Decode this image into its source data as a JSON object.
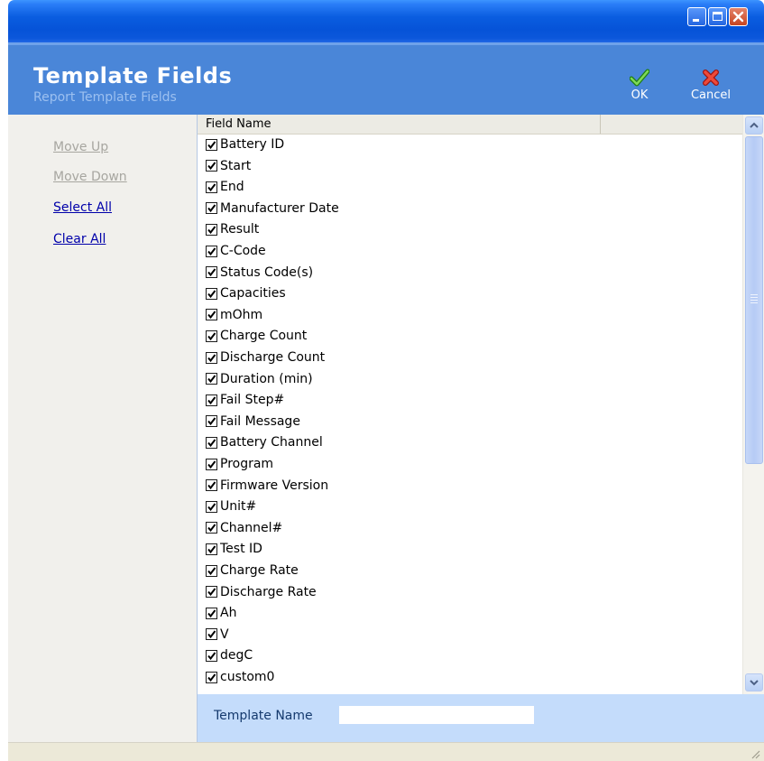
{
  "window": {
    "title": ""
  },
  "colors": {
    "header_bg": "#4a86d8",
    "titlebar": "#0653d8",
    "ok_green": "#2e9a20",
    "cancel_red": "#d9261c",
    "link_blue": "#0000aa"
  },
  "header": {
    "title": "Template Fields",
    "subtitle": "Report Template Fields",
    "ok_label": "OK",
    "cancel_label": "Cancel"
  },
  "sidebar": {
    "links": [
      {
        "label": "Move Up",
        "enabled": false
      },
      {
        "label": "Move Down",
        "enabled": false
      },
      {
        "label": "Select All",
        "enabled": true
      },
      {
        "label": "Clear All",
        "enabled": true
      }
    ]
  },
  "list": {
    "column_header": "Field Name",
    "fields": [
      {
        "label": "Battery ID",
        "checked": true
      },
      {
        "label": "Start",
        "checked": true
      },
      {
        "label": "End",
        "checked": true
      },
      {
        "label": "Manufacturer Date",
        "checked": true
      },
      {
        "label": "Result",
        "checked": true
      },
      {
        "label": "C-Code",
        "checked": true
      },
      {
        "label": "Status Code(s)",
        "checked": true
      },
      {
        "label": "Capacities",
        "checked": true
      },
      {
        "label": "mOhm",
        "checked": true
      },
      {
        "label": "Charge Count",
        "checked": true
      },
      {
        "label": "Discharge Count",
        "checked": true
      },
      {
        "label": "Duration (min)",
        "checked": true
      },
      {
        "label": "Fail Step#",
        "checked": true
      },
      {
        "label": "Fail Message",
        "checked": true
      },
      {
        "label": "Battery Channel",
        "checked": true
      },
      {
        "label": "Program",
        "checked": true
      },
      {
        "label": "Firmware Version",
        "checked": true
      },
      {
        "label": "Unit#",
        "checked": true
      },
      {
        "label": "Channel#",
        "checked": true
      },
      {
        "label": "Test ID",
        "checked": true
      },
      {
        "label": "Charge Rate",
        "checked": true
      },
      {
        "label": "Discharge Rate",
        "checked": true
      },
      {
        "label": "Ah",
        "checked": true
      },
      {
        "label": "V",
        "checked": true
      },
      {
        "label": "degC",
        "checked": true
      },
      {
        "label": "custom0",
        "checked": true
      }
    ]
  },
  "template": {
    "label": "Template Name",
    "value": ""
  }
}
